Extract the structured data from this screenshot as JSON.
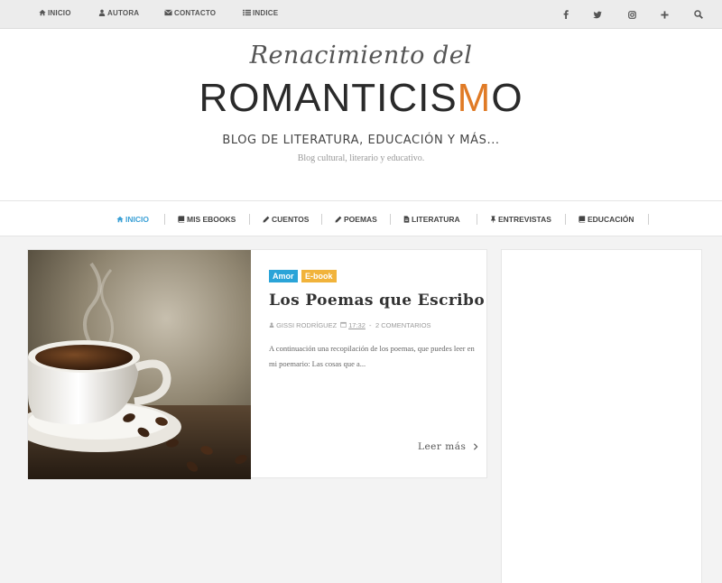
{
  "topbar": {
    "links": [
      {
        "label": "INICIO",
        "icon": "home-icon"
      },
      {
        "label": "AUTORA",
        "icon": "user-icon"
      },
      {
        "label": "CONTACTO",
        "icon": "envelope-icon"
      },
      {
        "label": "INDICE",
        "icon": "list-icon"
      }
    ],
    "social": [
      "facebook-icon",
      "twitter-icon",
      "instagram-icon",
      "plus-icon",
      "search-icon"
    ]
  },
  "header": {
    "script_title": "Renacimiento del",
    "main_title_start": "ROMANTICIS",
    "main_title_accent": "M",
    "main_title_end": "O",
    "tagline": "BLOG DE LITERATURA, EDUCACIÓN Y MÁS...",
    "description": "Blog cultural, literario y educativo.",
    "accent_color": "#e07a25"
  },
  "mainnav": {
    "items": [
      {
        "label": "INICIO",
        "icon": "home-icon",
        "active": true
      },
      {
        "label": "MIS EBOOKS",
        "icon": "book-icon"
      },
      {
        "label": "CUENTOS",
        "icon": "pencil-icon"
      },
      {
        "label": "POEMAS",
        "icon": "pencil-icon"
      },
      {
        "label": "LITERATURA",
        "icon": "file-icon"
      },
      {
        "label": "ENTREVISTAS",
        "icon": "pin-icon"
      },
      {
        "label": "EDUCACIÓN",
        "icon": "book-icon"
      }
    ],
    "active_color": "#3aa0d6"
  },
  "post": {
    "labels": [
      {
        "text": "Amor",
        "color": "#2aa4d8"
      },
      {
        "text": "E-book",
        "color": "#f1b33b"
      }
    ],
    "title": "Los Poemas que Escribo",
    "author": "GISSI RODRÍGUEZ",
    "time": "17:32",
    "separator": "-",
    "comments": "2 COMENTARIOS",
    "excerpt": "A continuación una recopilación de los poemas, que puedes leer en mi poemario: Las cosas que a...",
    "read_more": "Leer más",
    "image": "coffee-cup-image"
  }
}
